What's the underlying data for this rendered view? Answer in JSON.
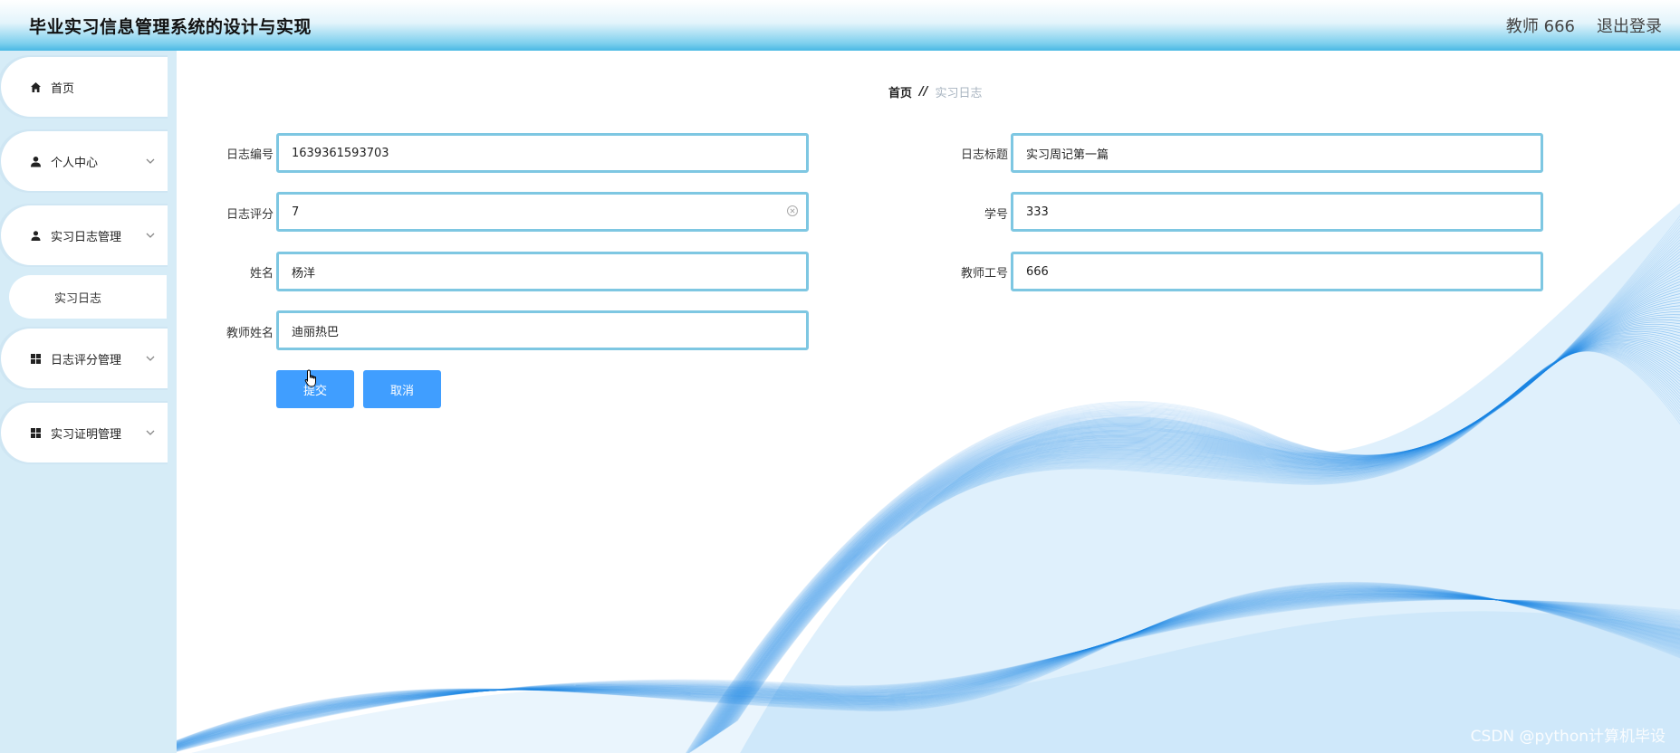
{
  "header": {
    "title": "毕业实习信息管理系统的设计与实现",
    "user": "教师 666",
    "logout": "退出登录"
  },
  "sidebar": {
    "items": [
      {
        "label": "首页",
        "icon": "home-icon"
      },
      {
        "label": "个人中心",
        "icon": "user-icon"
      },
      {
        "label": "实习日志管理",
        "icon": "user-icon"
      },
      {
        "label": "实习日志",
        "icon": ""
      },
      {
        "label": "日志评分管理",
        "icon": "grid-icon"
      },
      {
        "label": "实习证明管理",
        "icon": "grid-icon"
      }
    ]
  },
  "breadcrumb": {
    "home": "首页",
    "separator": "//",
    "current": "实习日志"
  },
  "form": {
    "log_id": {
      "label": "日志编号",
      "value": "1639361593703"
    },
    "log_title": {
      "label": "日志标题",
      "value": "实习周记第一篇"
    },
    "log_score": {
      "label": "日志评分",
      "value": "7"
    },
    "student_id": {
      "label": "学号",
      "value": "333"
    },
    "name": {
      "label": "姓名",
      "value": "杨洋"
    },
    "teacher_id": {
      "label": "教师工号",
      "value": "666"
    },
    "teacher_name": {
      "label": "教师姓名",
      "value": "迪丽热巴"
    },
    "submit": "提交",
    "cancel": "取消"
  },
  "watermark": "CSDN @python计算机毕设",
  "colors": {
    "accent": "#409eff",
    "field_border": "#7ec7e2",
    "sidebar_bg": "#d6ecf7",
    "wave": "#1e88e5"
  }
}
